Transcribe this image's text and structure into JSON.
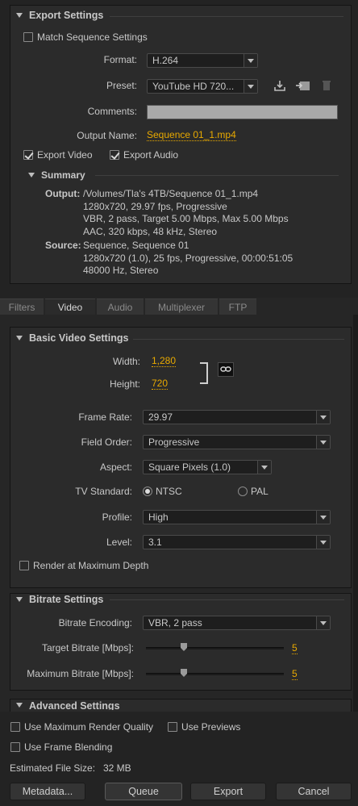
{
  "export_settings": {
    "title": "Export Settings",
    "match_sequence": {
      "label": "Match Sequence Settings",
      "checked": false
    },
    "format": {
      "label": "Format:",
      "value": "H.264"
    },
    "preset": {
      "label": "Preset:",
      "value": "YouTube HD 720..."
    },
    "preset_icons": [
      "save-preset-icon",
      "import-preset-icon",
      "delete-preset-icon"
    ],
    "comments": {
      "label": "Comments:",
      "value": ""
    },
    "output_name": {
      "label": "Output Name:",
      "value": "Sequence 01_1.mp4"
    },
    "export_video": {
      "label": "Export Video",
      "checked": true
    },
    "export_audio": {
      "label": "Export Audio",
      "checked": true
    }
  },
  "summary": {
    "title": "Summary",
    "output_label": "Output:",
    "output_lines": [
      "/Volumes/Tla's 4TB/Sequence 01_1.mp4",
      "1280x720, 29.97 fps, Progressive",
      "VBR, 2 pass, Target 5.00 Mbps, Max 5.00 Mbps",
      "AAC, 320 kbps, 48 kHz, Stereo"
    ],
    "source_label": "Source:",
    "source_lines": [
      "Sequence, Sequence 01",
      "1280x720 (1.0), 25 fps, Progressive, 00:00:51:05",
      "48000 Hz, Stereo"
    ]
  },
  "tabs": [
    "Filters",
    "Video",
    "Audio",
    "Multiplexer",
    "FTP"
  ],
  "active_tab": "Video",
  "basic_video": {
    "title": "Basic Video Settings",
    "width": {
      "label": "Width:",
      "value": "1,280"
    },
    "height": {
      "label": "Height:",
      "value": "720"
    },
    "frame_rate": {
      "label": "Frame Rate:",
      "value": "29.97"
    },
    "field_order": {
      "label": "Field Order:",
      "value": "Progressive"
    },
    "aspect": {
      "label": "Aspect:",
      "value": "Square Pixels (1.0)"
    },
    "tv_standard": {
      "label": "TV Standard:",
      "ntsc": "NTSC",
      "pal": "PAL",
      "selected": "NTSC"
    },
    "profile": {
      "label": "Profile:",
      "value": "High"
    },
    "level": {
      "label": "Level:",
      "value": "3.1"
    },
    "render_max_depth": {
      "label": "Render at Maximum Depth",
      "checked": false
    }
  },
  "bitrate": {
    "title": "Bitrate Settings",
    "encoding": {
      "label": "Bitrate Encoding:",
      "value": "VBR, 2 pass"
    },
    "target": {
      "label": "Target Bitrate [Mbps]:",
      "value": "5",
      "fraction": 0.28
    },
    "maximum": {
      "label": "Maximum Bitrate [Mbps]:",
      "value": "5",
      "fraction": 0.28
    }
  },
  "advanced": {
    "title": "Advanced Settings"
  },
  "options": {
    "max_render_quality": {
      "label": "Use Maximum Render Quality",
      "checked": false
    },
    "use_previews": {
      "label": "Use Previews",
      "checked": false
    },
    "frame_blending": {
      "label": "Use Frame Blending",
      "checked": false
    }
  },
  "file_size": {
    "label": "Estimated File Size:",
    "value": "32 MB"
  },
  "buttons": {
    "metadata": "Metadata...",
    "queue": "Queue",
    "export": "Export",
    "cancel": "Cancel"
  }
}
